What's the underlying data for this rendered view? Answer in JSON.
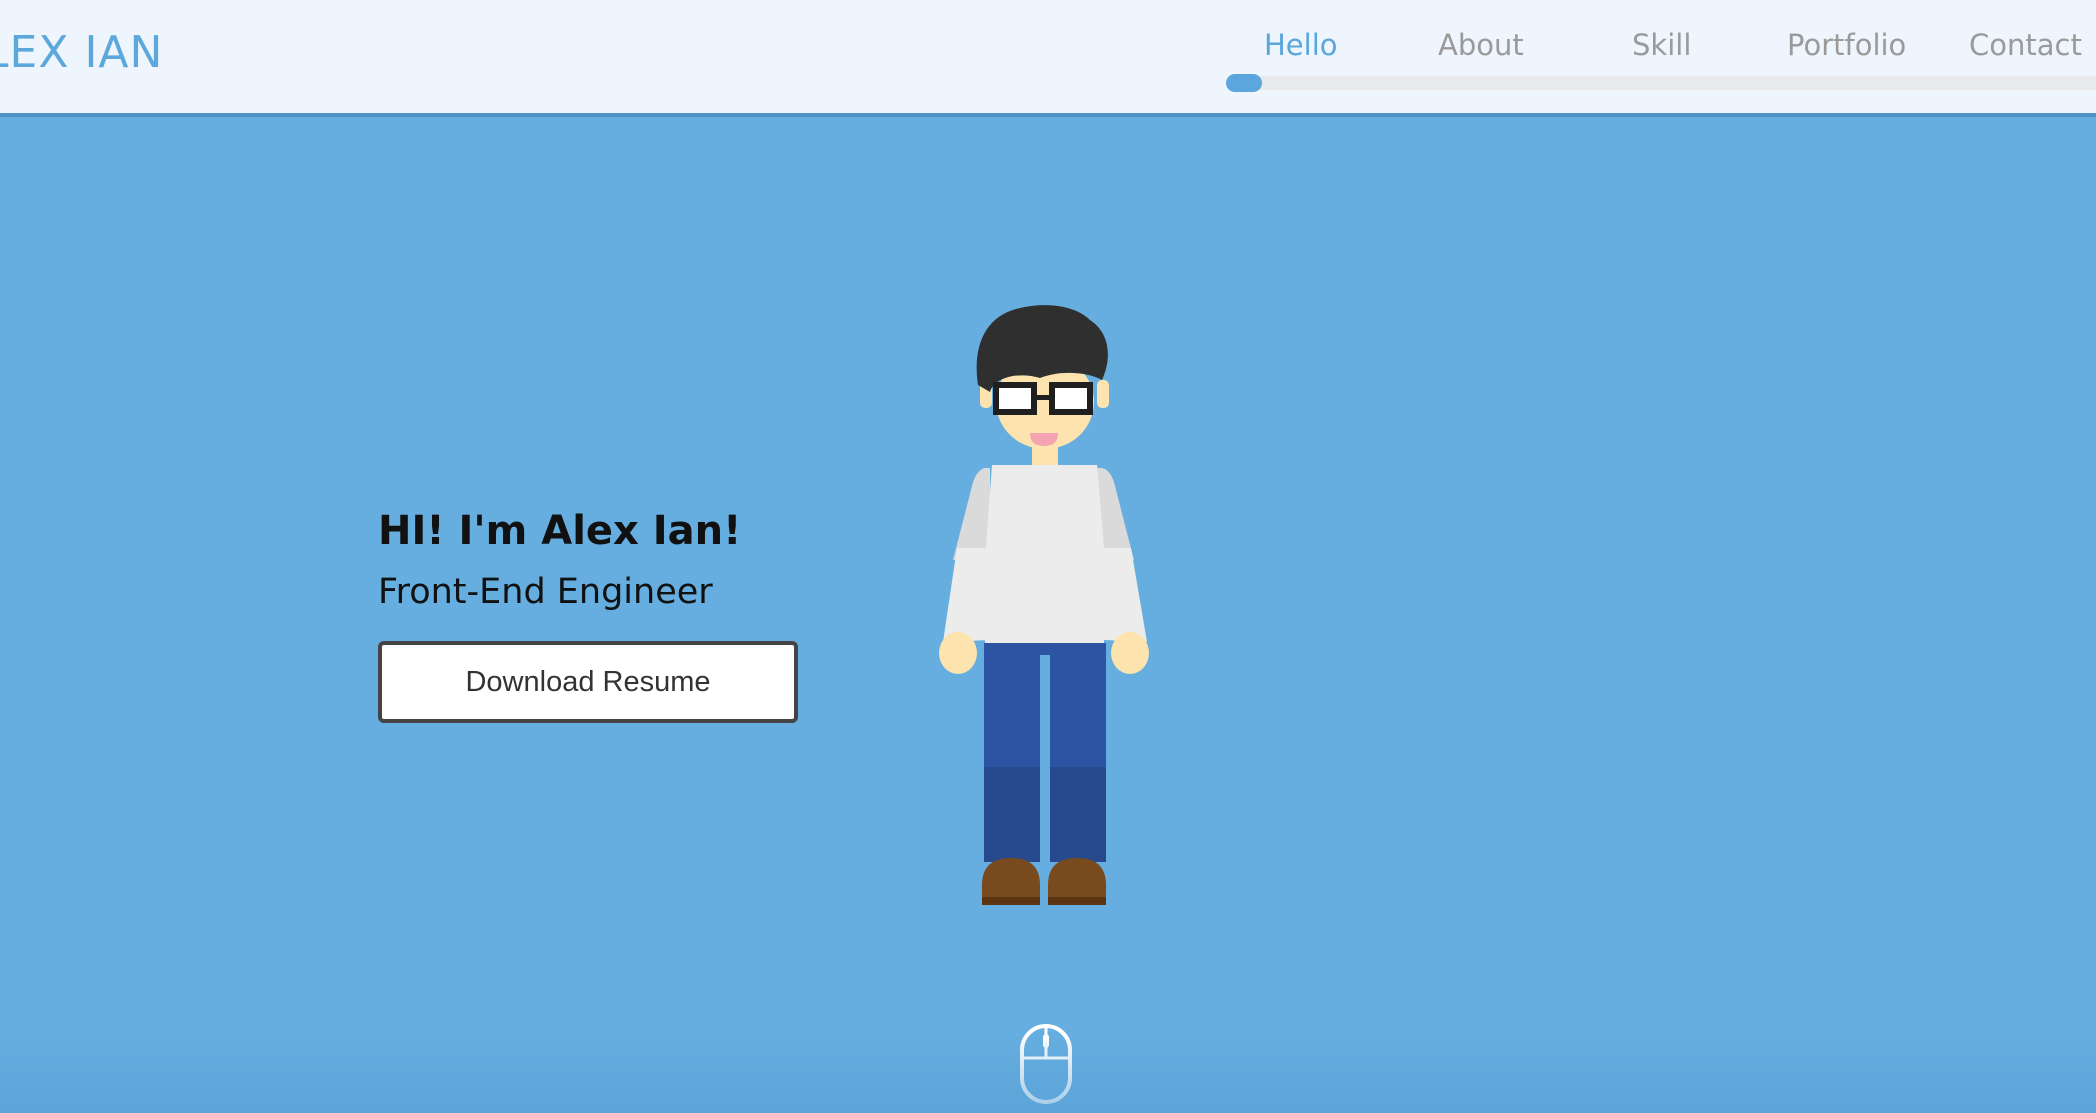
{
  "header": {
    "logo": "LEX IAN",
    "nav": [
      {
        "label": "Hello",
        "active": true
      },
      {
        "label": "About",
        "active": false
      },
      {
        "label": "Skill",
        "active": false
      },
      {
        "label": "Portfolio",
        "active": false
      },
      {
        "label": "Contact",
        "active": false
      }
    ]
  },
  "intro": {
    "title": "HI! I'm Alex Ian!",
    "subtitle": "Front-End Engineer",
    "download_label": "Download Resume"
  },
  "icons": {
    "avatar": "developer-avatar-illustration",
    "scroll": "mouse-scroll-icon"
  },
  "colors": {
    "background": "#65aedf",
    "header_bg": "#eef5fc",
    "accent": "#5aa6dd",
    "nav_inactive": "#9a9a9a"
  }
}
